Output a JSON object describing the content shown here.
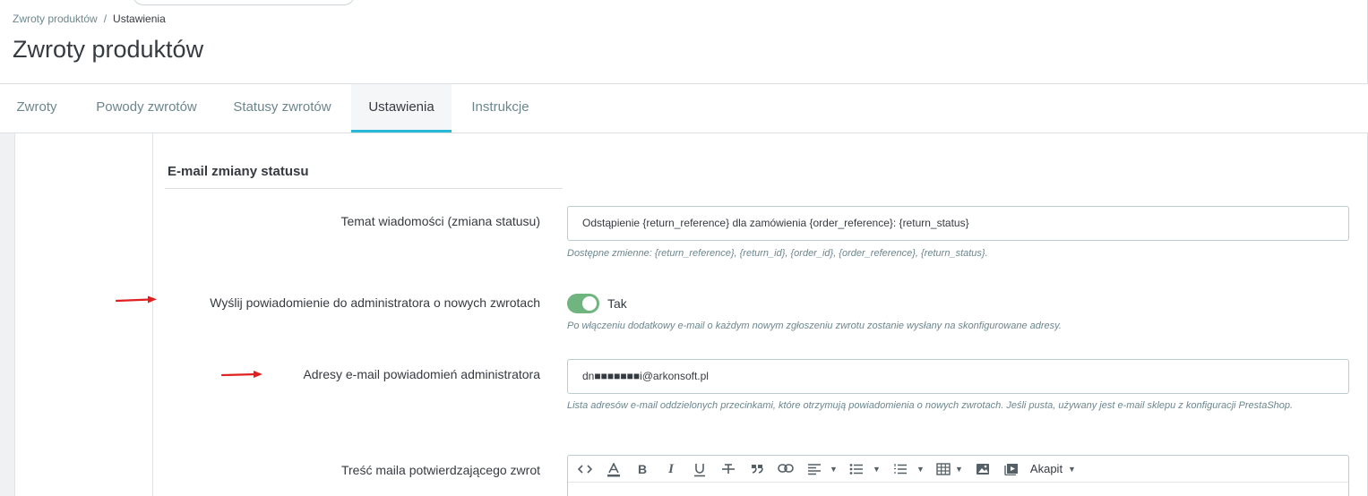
{
  "breadcrumb": {
    "parent": "Zwroty produktów",
    "separator": "/",
    "current": "Ustawienia"
  },
  "page": {
    "title": "Zwroty produktów"
  },
  "tabs": [
    {
      "label": "Zwroty"
    },
    {
      "label": "Powody zwrotów"
    },
    {
      "label": "Statusy zwrotów"
    },
    {
      "label": "Ustawienia",
      "active": true
    },
    {
      "label": "Instrukcje"
    }
  ],
  "section": {
    "title": "E-mail zmiany statusu"
  },
  "fields": {
    "subject": {
      "label": "Temat wiadomości (zmiana statusu)",
      "value": "Odstąpienie {return_reference} dla zamówienia {order_reference}: {return_status}",
      "help": "Dostępne zmienne: {return_reference}, {return_id}, {order_id}, {order_reference}, {return_status}."
    },
    "notify_admin": {
      "label": "Wyślij powiadomienie do administratora o nowych zwrotach",
      "state": "on",
      "state_label": "Tak",
      "help": "Po włączeniu dodatkowy e-mail o każdym nowym zgłoszeniu zwrotu zostanie wysłany na skonfigurowane adresy."
    },
    "admin_emails": {
      "label": "Adresy e-mail powiadomień administratora",
      "value": "dn■■■■■■■i@arkonsoft.pl",
      "help": "Lista adresów e-mail oddzielonych przecinkami, które otrzymują powiadomienia o nowych zwrotach. Jeśli pusta, używany jest e-mail sklepu z konfiguracji PrestaShop."
    },
    "confirmation_body": {
      "label": "Treść maila potwierdzającego zwrot",
      "paragraph_format": "Akapit"
    }
  },
  "toolbar_icons": [
    "code-view-icon",
    "font-color-icon",
    "bold-icon",
    "italic-icon",
    "underline-icon",
    "strikethrough-icon",
    "blockquote-icon",
    "link-icon",
    "align-icon",
    "unordered-list-icon",
    "ordered-list-icon",
    "table-icon",
    "image-icon",
    "video-icon"
  ],
  "colors": {
    "accent": "#25b9d7",
    "switch_on": "#70b580",
    "annotation_arrow": "#e02020"
  }
}
